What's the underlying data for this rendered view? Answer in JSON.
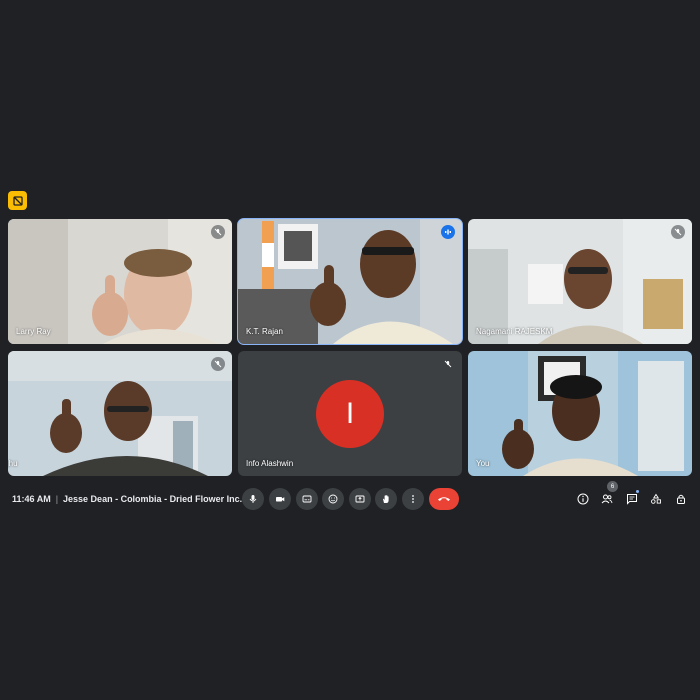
{
  "meeting": {
    "time": "11:46 AM",
    "separator": "|",
    "title": "Jesse Dean - Colombia - Dried Flower Inc..."
  },
  "participants": [
    {
      "name": "Larry Ray",
      "state": "muted"
    },
    {
      "name": "K.T. Rajan",
      "state": "speaking"
    },
    {
      "name": "Nagamani RAJESKM",
      "state": "muted"
    },
    {
      "name": "Raghu",
      "state": "muted"
    },
    {
      "name": "Info Alashwin",
      "state": "muted",
      "avatar_letter": "I",
      "avatar_color": "#d93025"
    },
    {
      "name": "You",
      "state": "none"
    }
  ],
  "controls": [
    "mic-icon",
    "camera-icon",
    "captions-icon",
    "emoji-icon",
    "present-icon",
    "raise-hand-icon",
    "more-options-icon",
    "end-call-icon"
  ],
  "right_controls": {
    "people_count": "6",
    "icons": [
      "info-icon",
      "people-icon",
      "chat-icon",
      "activities-icon",
      "host-controls-icon"
    ]
  },
  "colors": {
    "background": "#202124",
    "tile": "#3c4043",
    "accent": "#8ab4f8",
    "end_call": "#ea4335",
    "badge": "#fbbc04"
  }
}
